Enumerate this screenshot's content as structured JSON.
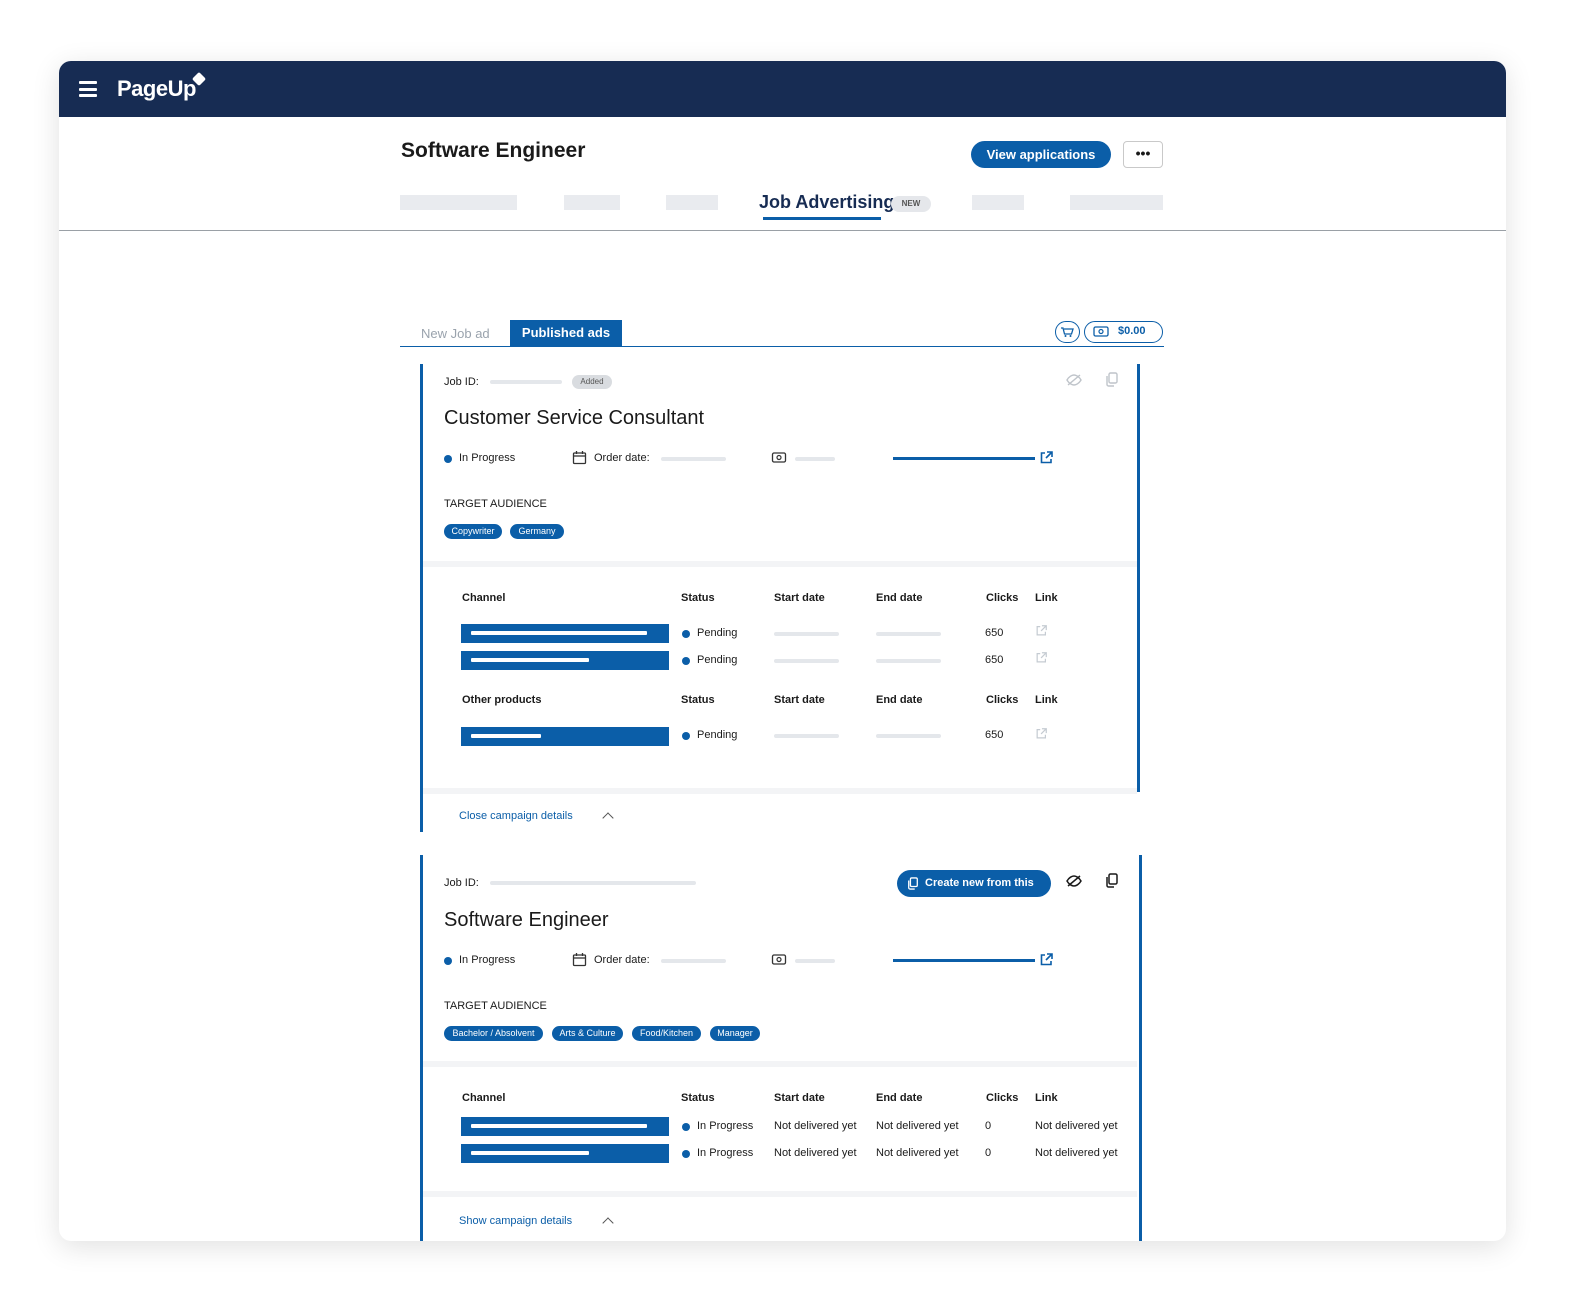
{
  "header": {
    "logo_text": "PageUp",
    "page_title": "Software Engineer",
    "view_applications_label": "View applications",
    "more_label": "•••"
  },
  "main_tabs": {
    "active_label": "Job Advertising",
    "new_badge": "NEW"
  },
  "sub_tabs": {
    "new_job_ad": "New Job ad",
    "published_ads": "Published ads",
    "budget": "$0.00"
  },
  "campaigns": [
    {
      "job_id_label": "Job ID:",
      "badge": "Added",
      "title": "Customer Service Consultant",
      "status": "In Progress",
      "order_date_label": "Order date:",
      "target_audience_label": "TARGET AUDIENCE",
      "tags": [
        "Copywriter",
        "Germany"
      ],
      "channel_headers": {
        "channel": "Channel",
        "status": "Status",
        "start": "Start date",
        "end": "End date",
        "clicks": "Clicks",
        "link": "Link"
      },
      "channel_rows": [
        {
          "status": "Pending",
          "clicks": "650"
        },
        {
          "status": "Pending",
          "clicks": "650"
        }
      ],
      "other_headers": {
        "channel": "Other products",
        "status": "Status",
        "start": "Start date",
        "end": "End date",
        "clicks": "Clicks",
        "link": "Link"
      },
      "other_rows": [
        {
          "status": "Pending",
          "clicks": "650"
        }
      ],
      "toggle_label": "Close campaign details"
    },
    {
      "job_id_label": "Job ID:",
      "create_button": "Create new from this",
      "title": "Software Engineer",
      "status": "In Progress",
      "order_date_label": "Order date:",
      "target_audience_label": "TARGET AUDIENCE",
      "tags": [
        "Bachelor / Absolvent",
        "Arts & Culture",
        "Food/Kitchen",
        "Manager"
      ],
      "channel_headers": {
        "channel": "Channel",
        "status": "Status",
        "start": "Start date",
        "end": "End date",
        "clicks": "Clicks",
        "link": "Link"
      },
      "channel_rows": [
        {
          "status": "In Progress",
          "start": "Not delivered yet",
          "end": "Not delivered yet",
          "clicks": "0",
          "link": "Not delivered yet"
        },
        {
          "status": "In Progress",
          "start": "Not delivered yet",
          "end": "Not delivered yet",
          "clicks": "0",
          "link": "Not delivered yet"
        }
      ],
      "toggle_label": "Show campaign details"
    }
  ],
  "colors": {
    "navy": "#172c53",
    "primary": "#0b5ea8",
    "placeholder": "#e4e7eb"
  }
}
